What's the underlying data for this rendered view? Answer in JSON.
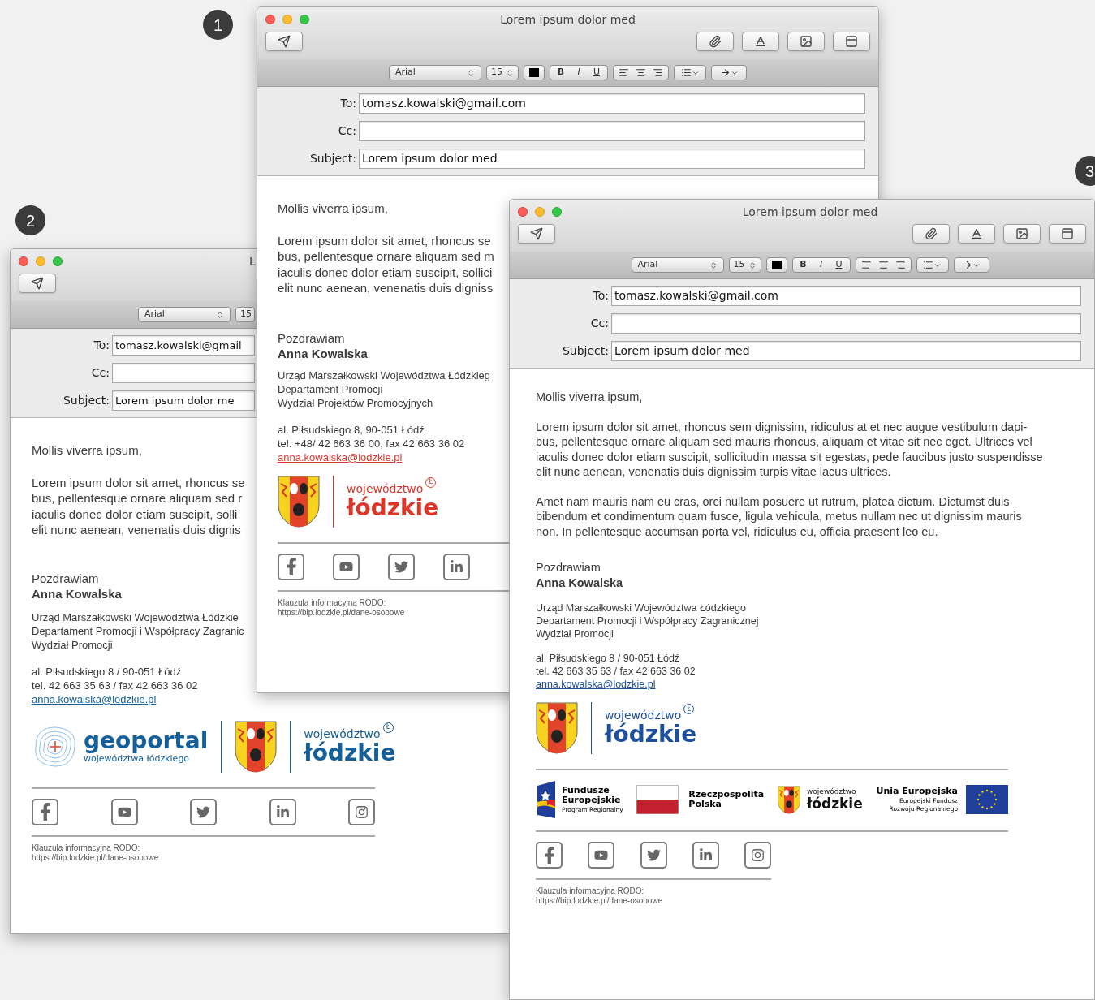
{
  "badges": [
    {
      "number": "1"
    },
    {
      "number": "2"
    },
    {
      "number": "3"
    }
  ],
  "windows": [
    {
      "title": "Lorem ipsum dolor med",
      "toolbar_buttons": [
        {
          "kind": "send"
        },
        {
          "kind": "attach"
        },
        {
          "kind": "fonts"
        },
        {
          "kind": "photo"
        },
        {
          "kind": "template"
        }
      ],
      "format_bar": {
        "font": "Arial",
        "size": "15",
        "styles": [
          "B",
          "I",
          "U"
        ]
      },
      "fields": [
        {
          "label": "To:",
          "value": "tomasz.kowalski@gmail.com"
        },
        {
          "label": "Cc:"
        },
        {
          "label": "Subject:",
          "value": "Lorem ipsum dolor med"
        }
      ],
      "greeting": "Mollis viverra ipsum,",
      "paragraphs": [
        [
          "Lorem ipsum dolor sit amet, rhoncus se",
          "bus, pellentesque ornare aliquam sed m",
          "iaculis donec dolor etiam suscipit, sollici",
          "elit nunc aenean, venenatis duis digniss"
        ]
      ],
      "closing": "Pozdrawiam",
      "name": "Anna Kowalska",
      "organization": [
        "Urząd Marszałkowski Województwa Łódzkieg",
        "Departament Promocji",
        "Wydział Projektów Promocyjnych"
      ],
      "address": [
        "al. Piłsudskiego 8, 90-051 Łódź",
        "tel. +48/ 42 663 36 00, fax 42 663 36 02"
      ],
      "email": "anna.kowalska@lodzkie.pl",
      "logos": [
        {
          "kind": "crest"
        },
        {
          "kind": "wordmark",
          "top": "województwo",
          "bottom": "łódzkie",
          "mark": "Ł",
          "color": "#d9372a"
        }
      ],
      "social": [
        {
          "kind": "facebook"
        },
        {
          "kind": "youtube"
        },
        {
          "kind": "twitter"
        },
        {
          "kind": "linkedin"
        }
      ],
      "footer": [
        "Klauzula informacyjna RODO:",
        "https://bip.lodzkie.pl/dane-osobowe"
      ]
    },
    {
      "title": "L",
      "toolbar_buttons": [
        {
          "kind": "send"
        }
      ],
      "format_bar": {
        "font": "Arial",
        "size": "15"
      },
      "fields": [
        {
          "label": "To:",
          "value": "tomasz.kowalski@gmail"
        },
        {
          "label": "Cc:"
        },
        {
          "label": "Subject:",
          "value": "Lorem ipsum dolor me"
        }
      ],
      "greeting": "Mollis viverra ipsum,",
      "paragraphs": [
        [
          "Lorem ipsum dolor sit amet, rhoncus se",
          "bus, pellentesque ornare aliquam sed r",
          "iaculis donec dolor etiam suscipit, solli",
          "elit nunc aenean, venenatis duis dignis"
        ]
      ],
      "closing": "Pozdrawiam",
      "name": "Anna Kowalska",
      "organization": [
        "Urząd Marszałkowski Województwa Łódzkie",
        "Departament Promocji i Współpracy Zagranic",
        "Wydział Promocji"
      ],
      "address": [
        "al. Piłsudskiego 8 / 90-051 Łódź",
        "tel. 42 663 35 63 / fax 42 663 36 02"
      ],
      "email": "anna.kowalska@lodzkie.pl",
      "logos": [
        {
          "kind": "geoportal",
          "top": "geoportal",
          "bottom": "województwa łódzkiego"
        },
        {
          "kind": "crest"
        },
        {
          "kind": "wordmark",
          "top": "województwo",
          "bottom": "łódzkie",
          "mark": "Ł",
          "color": "#16609a"
        }
      ],
      "social": [
        {
          "kind": "facebook"
        },
        {
          "kind": "youtube"
        },
        {
          "kind": "twitter"
        },
        {
          "kind": "linkedin"
        },
        {
          "kind": "instagram"
        }
      ],
      "footer": [
        "Klauzula informacyjna RODO:",
        "https://bip.lodzkie.pl/dane-osobowe"
      ]
    },
    {
      "title": "Lorem ipsum dolor med",
      "toolbar_buttons": [
        {
          "kind": "send"
        },
        {
          "kind": "attach"
        },
        {
          "kind": "fonts"
        },
        {
          "kind": "photo"
        },
        {
          "kind": "template"
        }
      ],
      "format_bar": {
        "font": "Arial",
        "size": "15",
        "styles": [
          "B",
          "I",
          "U"
        ]
      },
      "fields": [
        {
          "label": "To:",
          "value": "tomasz.kowalski@gmail.com"
        },
        {
          "label": "Cc:"
        },
        {
          "label": "Subject:",
          "value": "Lorem ipsum dolor med"
        }
      ],
      "greeting": "Mollis viverra ipsum,",
      "paragraphs": [
        [
          "Lorem ipsum dolor sit amet, rhoncus sem dignissim, ridiculus at et nec augue vestibulum dapi-",
          "bus, pellentesque ornare aliquam sed mauris rhoncus, aliquam et vitae sit nec eget. Ultrices vel",
          "iaculis donec dolor etiam suscipit, sollicitudin massa sit egestas, pede faucibus justo suspendisse",
          "elit nunc aenean, venenatis duis dignissim turpis vitae lacus ultrices."
        ],
        [
          "Amet nam mauris nam eu cras, orci nullam posuere ut rutrum, platea dictum. Dictumst duis",
          "bibendum et condimentum quam fusce, ligula vehicula, metus nullam nec ut dignissim mauris",
          "non. In pellentesque accumsan porta vel, ridiculus eu, officia praesent leo eu."
        ]
      ],
      "closing": "Pozdrawiam",
      "name": "Anna Kowalska",
      "organization": [
        "Urząd Marszałkowski Województwa Łódzkiego",
        "Departament Promocji i Współpracy Zagranicznej",
        "Wydział Promocji"
      ],
      "address": [
        "al. Piłsudskiego 8 / 90-051 Łódź",
        "tel. 42 663 35 63 / fax 42 663 36 02"
      ],
      "email": "anna.kowalska@lodzkie.pl",
      "logos": [
        {
          "kind": "crest"
        },
        {
          "kind": "wordmark",
          "top": "województwo",
          "bottom": "łódzkie",
          "mark": "Ł",
          "color": "#1d4f9c"
        }
      ],
      "funding_logos": [
        {
          "kind": "fe",
          "lines": [
            "Fundusze",
            "Europejskie",
            "Program Regionalny"
          ]
        },
        {
          "kind": "pl_flag",
          "lines": [
            "Rzeczpospolita",
            "Polska"
          ]
        },
        {
          "kind": "region",
          "lines": [
            "województwo",
            "łódzkie"
          ]
        },
        {
          "kind": "eu",
          "lines": [
            "Unia Europejska",
            "Europejski Fundusz",
            "Rozwoju Regionalnego"
          ]
        }
      ],
      "social": [
        {
          "kind": "facebook"
        },
        {
          "kind": "youtube"
        },
        {
          "kind": "twitter"
        },
        {
          "kind": "linkedin"
        },
        {
          "kind": "instagram"
        }
      ],
      "footer": [
        "Klauzula informacyjna RODO:",
        "https://bip.lodzkie.pl/dane-osobowe"
      ]
    }
  ]
}
